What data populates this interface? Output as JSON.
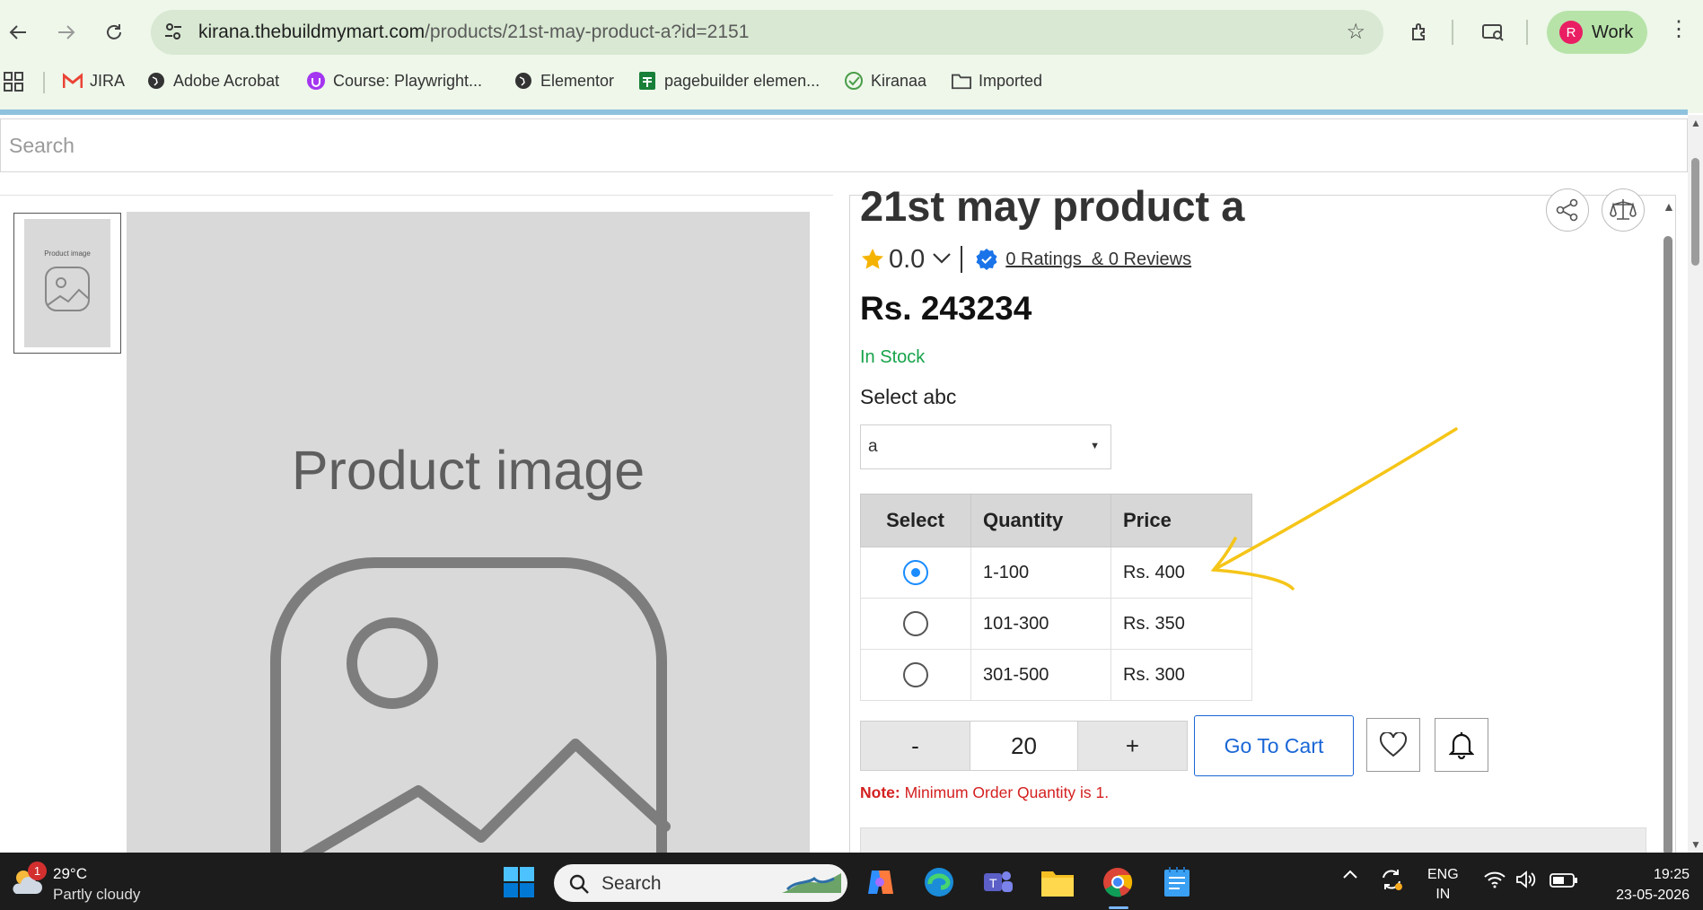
{
  "browser": {
    "url_host": "kirana.thebuildmymart.com",
    "url_path": "/products/21st-may-product-a?id=2151",
    "profile_initial": "R",
    "profile_label": "Work"
  },
  "bookmarks": [
    {
      "label": "JIRA",
      "icon": "gmail-icon"
    },
    {
      "label": "Adobe Acrobat",
      "icon": "globe-icon"
    },
    {
      "label": "Course: Playwright...",
      "icon": "course-icon"
    },
    {
      "label": "Elementor",
      "icon": "globe-icon"
    },
    {
      "label": "pagebuilder elemen...",
      "icon": "sheets-icon"
    },
    {
      "label": "Kiranaa",
      "icon": "check-icon"
    },
    {
      "label": "Imported",
      "icon": "folder-icon"
    }
  ],
  "search": {
    "placeholder": "Search"
  },
  "gallery": {
    "thumb_label": "Product image",
    "main_label": "Product image"
  },
  "product": {
    "title": "21st may product a",
    "rating": "0.0",
    "ratings_text": "0 Ratings  & 0 Reviews",
    "price": "Rs. 243234",
    "stock": "In Stock",
    "select_label": "Select abc",
    "select_value": "a"
  },
  "tiers": {
    "headers": [
      "Select",
      "Quantity",
      "Price"
    ],
    "rows": [
      {
        "quantity": "1-100",
        "price": "Rs. 400",
        "selected": true
      },
      {
        "quantity": "101-300",
        "price": "Rs. 350",
        "selected": false
      },
      {
        "quantity": "301-500",
        "price": "Rs. 300",
        "selected": false
      }
    ]
  },
  "quantity": {
    "minus": "-",
    "value": "20",
    "plus": "+"
  },
  "cart_button": "Go To Cart",
  "note": {
    "prefix": "Note:",
    "text": " Minimum Order Quantity is 1."
  },
  "taskbar": {
    "badge": "1",
    "temperature": "29°C",
    "weather": "Partly cloudy",
    "search_label": "Search",
    "lang_top": "ENG",
    "lang_bottom": "IN",
    "time": "19:25",
    "date": "23-05-2026"
  },
  "colors": {
    "accent": "#1a66d6",
    "stock": "#16a34a",
    "note": "#d42020",
    "annotation": "#f5c518"
  }
}
